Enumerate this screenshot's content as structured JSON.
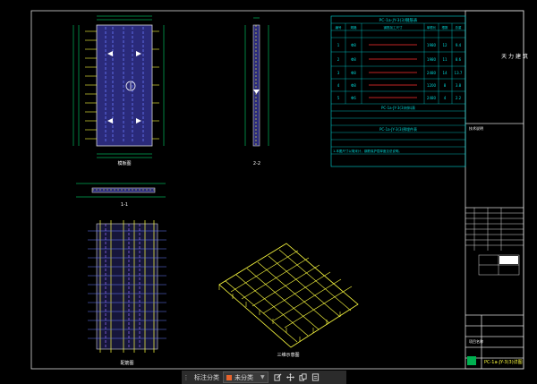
{
  "colors": {
    "background": "#000000",
    "frame": "#d8d8d8",
    "table_line": "#00d8d8",
    "table_text": "#00d8d8",
    "dimension": "#00ff80",
    "panel_fill": "#2a2a7a",
    "rebar_yellow": "#ffff40",
    "rebar_blue": "#6b7cff",
    "rebar_violet": "#a070ff",
    "red_text": "#ff3030",
    "magenta_text": "#ff40ff",
    "white": "#ffffff",
    "accent": "#e8632c"
  },
  "drawing": {
    "view_labels": {
      "plan": "模板图",
      "section_11": "1-1",
      "section_22": "2-2",
      "rebar_plan": "配筋图",
      "isometric": "三维示意图"
    }
  },
  "table": {
    "title1": "PC-1a-JY-3(3)钢筋表",
    "header": [
      "编号",
      "规格",
      "钢筋加工尺寸",
      "单根长",
      "根数",
      "总长",
      "总重"
    ],
    "rows": [
      {
        "id": "1",
        "spec": "Φ8",
        "len": "1980",
        "n": "12",
        "tot": "23.8",
        "wt": "9.4"
      },
      {
        "id": "2",
        "spec": "Φ8",
        "len": "1980",
        "n": "11",
        "tot": "21.8",
        "wt": "8.6"
      },
      {
        "id": "3",
        "spec": "Φ8",
        "len": "2480",
        "n": "14",
        "tot": "34.7",
        "wt": "13.7"
      },
      {
        "id": "4",
        "spec": "Φ8",
        "len": "1200",
        "n": "8",
        "tot": "9.6",
        "wt": "3.8"
      },
      {
        "id": "5",
        "spec": "Φ6",
        "len": "2480",
        "n": "4",
        "tot": "9.9",
        "wt": "2.2"
      }
    ],
    "title2": "PC-1a-JY-3(3)材料表",
    "title3": "PC-1a-JY-3(3)预埋件表",
    "note_label": "技术说明",
    "notes": "1.本图尺寸以毫米计，钢筋保护层厚度见总说明。"
  },
  "title_block": {
    "company": "天 力 建 筑",
    "project_label": "项目名称",
    "drawing_name": "PC-1a-JY-3(3)详图"
  },
  "toolbar": {
    "label": "标注分类",
    "category": "未分类",
    "icons": [
      "edit-icon",
      "move-icon",
      "copy-icon",
      "download-icon"
    ]
  }
}
